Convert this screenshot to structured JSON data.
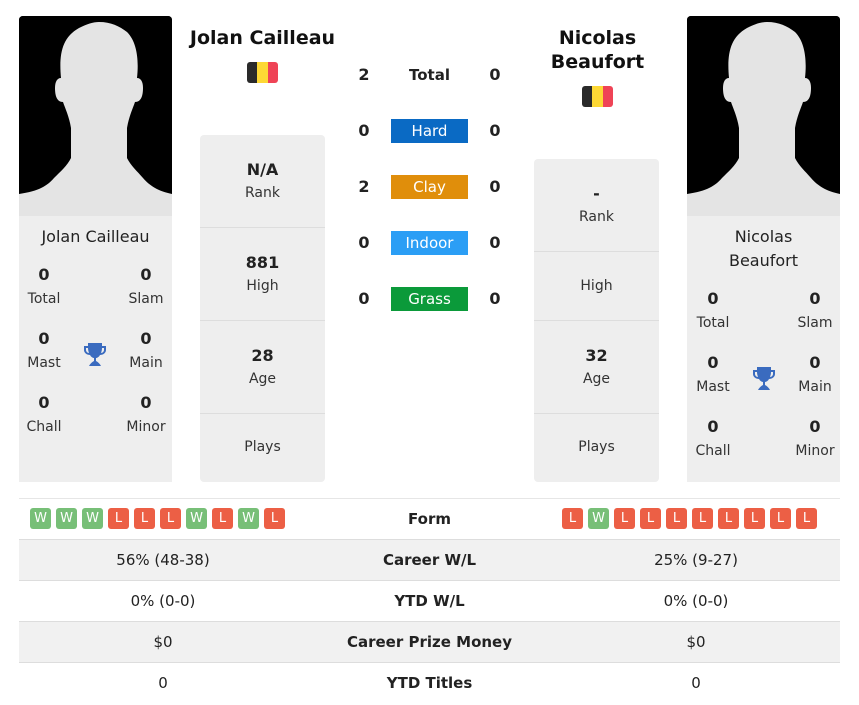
{
  "players": {
    "left": {
      "name": "Jolan Cailleau",
      "header_name": "Jolan Cailleau",
      "panel_name_lines": [
        "Jolan Cailleau"
      ],
      "flag": "belgium-flag",
      "titles": {
        "total": {
          "value": "0",
          "label": "Total"
        },
        "slam": {
          "value": "0",
          "label": "Slam"
        },
        "mast": {
          "value": "0",
          "label": "Mast"
        },
        "main": {
          "value": "0",
          "label": "Main"
        },
        "chall": {
          "value": "0",
          "label": "Chall"
        },
        "minor": {
          "value": "0",
          "label": "Minor"
        }
      },
      "rank": {
        "value": "N/A",
        "label": "Rank"
      },
      "high": {
        "value": "881",
        "label": "High"
      },
      "age": {
        "value": "28",
        "label": "Age"
      },
      "plays": {
        "value": "",
        "label": "Plays"
      },
      "form": [
        "W",
        "W",
        "W",
        "L",
        "L",
        "L",
        "W",
        "L",
        "W",
        "L"
      ],
      "career_wl": "56% (48-38)",
      "ytd_wl": "0% (0-0)",
      "prize_money": "$0",
      "ytd_titles": "0"
    },
    "right": {
      "name": "Nicolas Beaufort",
      "header_name_lines": [
        "Nicolas",
        "Beaufort"
      ],
      "panel_name_lines": [
        "Nicolas",
        "Beaufort"
      ],
      "flag": "belgium-flag",
      "titles": {
        "total": {
          "value": "0",
          "label": "Total"
        },
        "slam": {
          "value": "0",
          "label": "Slam"
        },
        "mast": {
          "value": "0",
          "label": "Mast"
        },
        "main": {
          "value": "0",
          "label": "Main"
        },
        "chall": {
          "value": "0",
          "label": "Chall"
        },
        "minor": {
          "value": "0",
          "label": "Minor"
        }
      },
      "rank": {
        "value": "-",
        "label": "Rank"
      },
      "high": {
        "value": "",
        "label": "High"
      },
      "age": {
        "value": "32",
        "label": "Age"
      },
      "plays": {
        "value": "",
        "label": "Plays"
      },
      "form": [
        "L",
        "W",
        "L",
        "L",
        "L",
        "L",
        "L",
        "L",
        "L",
        "L"
      ],
      "career_wl": "25% (9-27)",
      "ytd_wl": "0% (0-0)",
      "prize_money": "$0",
      "ytd_titles": "0"
    }
  },
  "h2h": [
    {
      "label": "Total",
      "left": "2",
      "right": "0",
      "color": ""
    },
    {
      "label": "Hard",
      "left": "0",
      "right": "0",
      "color": "#0a6ac4"
    },
    {
      "label": "Clay",
      "left": "2",
      "right": "0",
      "color": "#e08e0b"
    },
    {
      "label": "Indoor",
      "left": "0",
      "right": "0",
      "color": "#2b9ef5"
    },
    {
      "label": "Grass",
      "left": "0",
      "right": "0",
      "color": "#0b9a3a"
    }
  ],
  "stats_labels": {
    "form": "Form",
    "career_wl": "Career W/L",
    "ytd_wl": "YTD W/L",
    "prize_money": "Career Prize Money",
    "ytd_titles": "YTD Titles"
  },
  "colors": {
    "win": "#77bf77",
    "loss": "#ec5f45",
    "trophy": "#3a6bbf",
    "flag_black": "#2a2a2a",
    "flag_yellow": "#fdd835",
    "flag_red": "#ef4356"
  }
}
